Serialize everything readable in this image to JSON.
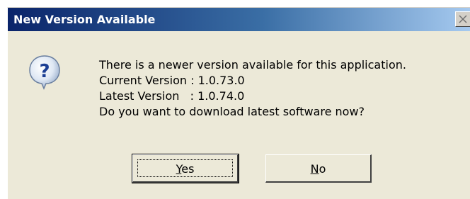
{
  "dialog": {
    "title": "New Version Available",
    "icon": "question-icon",
    "message_lines": [
      "There is a newer version available for this application.",
      "Current Version : 1.0.73.0",
      "Latest Version   : 1.0.74.0",
      "Do you want to download latest software now?"
    ],
    "buttons": {
      "yes": {
        "mnemonic": "Y",
        "rest": "es"
      },
      "no": {
        "mnemonic": "N",
        "rest": "o"
      }
    }
  }
}
